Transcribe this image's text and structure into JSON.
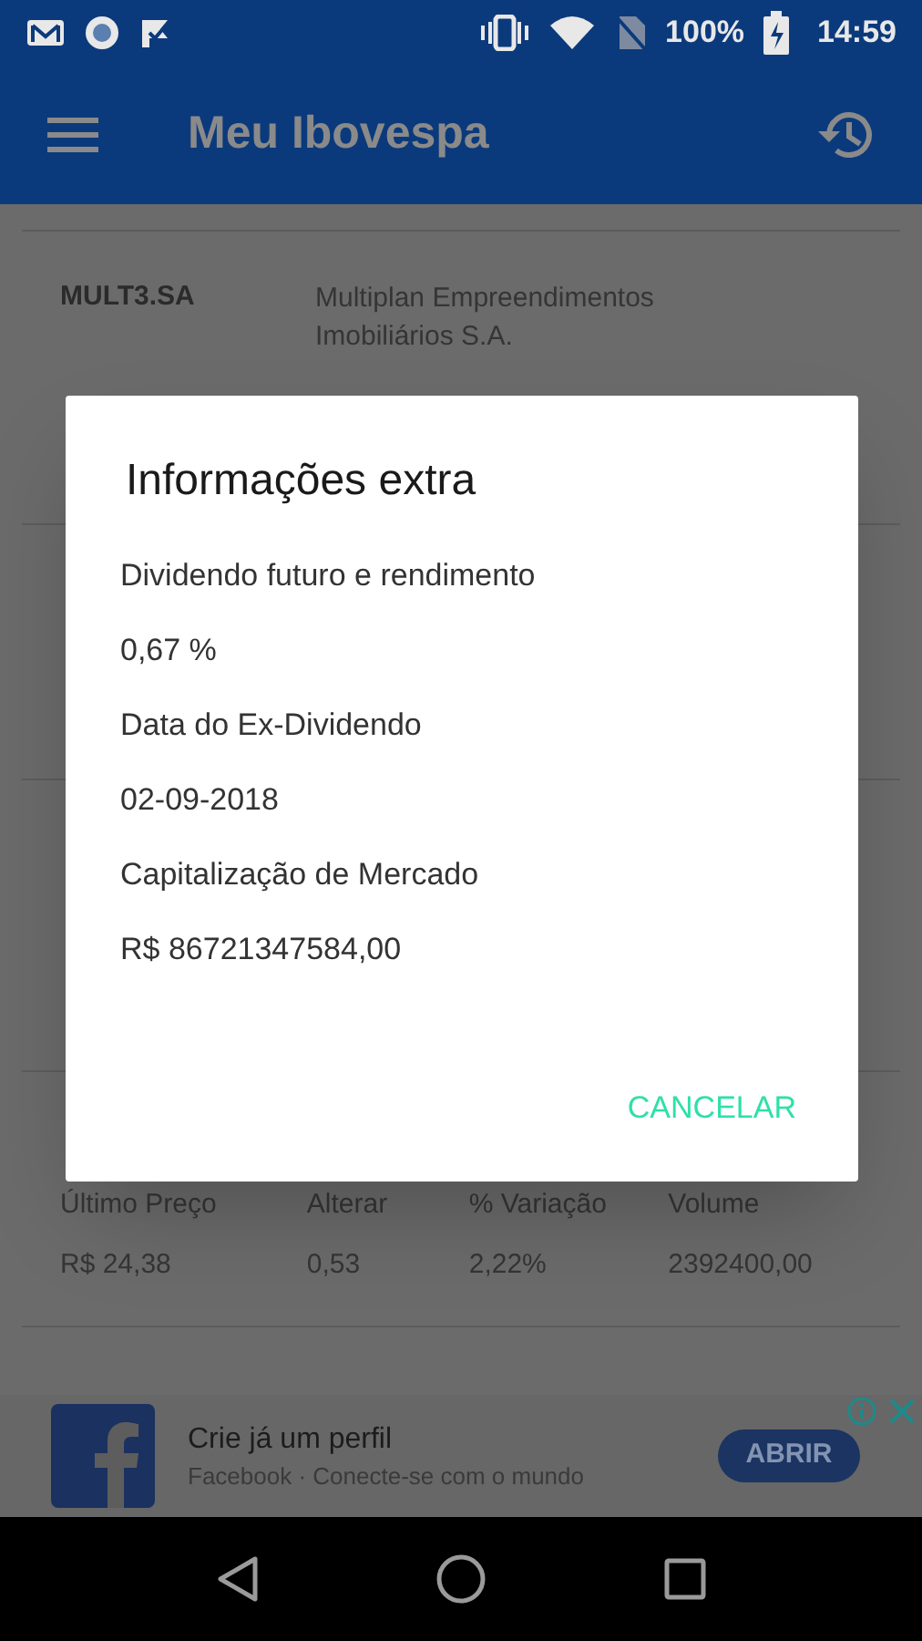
{
  "status_bar": {
    "battery": "100%",
    "time": "14:59"
  },
  "app_bar": {
    "title": "Meu Ibovespa"
  },
  "rows": [
    {
      "ticker": "MULT3.SA",
      "name": "Multiplan Empreendimentos Imobiliários S.A."
    },
    {},
    {},
    {
      "labels": [
        "Último Preço",
        "Alterar",
        "% Variação",
        "Volume"
      ],
      "values": [
        "R$ 24,38",
        "0,53",
        "2,22%",
        "2392400,00"
      ]
    },
    {}
  ],
  "dialog": {
    "title": "Informações extra",
    "lines": [
      "Dividendo futuro e rendimento",
      "0,67 %",
      "Data do Ex-Dividendo",
      "02-09-2018",
      "Capitalização de Mercado",
      "R$ 86721347584,00"
    ],
    "button": "CANCELAR"
  },
  "ad": {
    "title": "Crie já um perfil",
    "subtitle": "Facebook · Conecte-se com o mundo",
    "button": "ABRIR"
  }
}
